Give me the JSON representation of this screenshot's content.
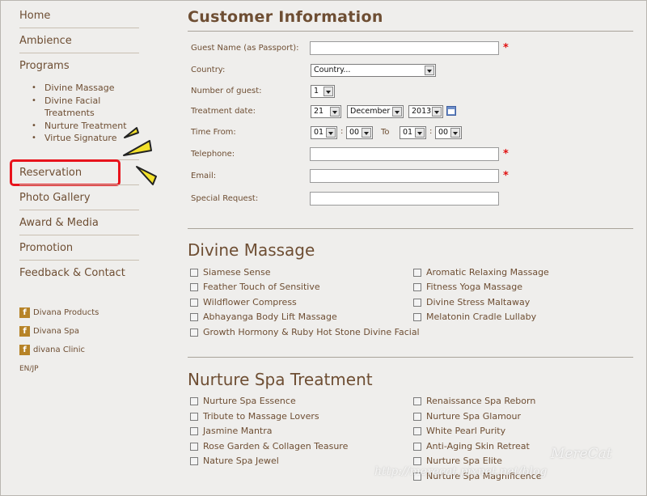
{
  "nav": {
    "home": "Home",
    "ambience": "Ambience",
    "programs": "Programs",
    "programs_sub": [
      "Divine Massage",
      "Divine Facial",
      "Treatments",
      "Nurture Treatment",
      "Virtue Signature"
    ],
    "reservation": "Reservation",
    "photo_gallery": "Photo Gallery",
    "award_media": "Award & Media",
    "promotion": "Promotion",
    "feedback": "Feedback & Contact"
  },
  "social": [
    {
      "icon": "facebook-icon",
      "label": "Divana Products"
    },
    {
      "icon": "facebook-icon",
      "label": "Divana Spa"
    },
    {
      "icon": "facebook-icon",
      "label": "divana Clinic"
    }
  ],
  "language": "EN/JP",
  "form": {
    "title": "Customer Information",
    "guest_name_label": "Guest Name (as Passport):",
    "country_label": "Country:",
    "country_value": "Country...",
    "guests_label": "Number of guest:",
    "guests_value": "1",
    "date_label": "Treatment date:",
    "day_value": "21",
    "month_value": "December",
    "year_value": "2013",
    "time_label": "Time From:",
    "hour_from": "01",
    "minute_from": "00",
    "time_to_label": "To",
    "hour_to": "01",
    "minute_to": "00",
    "telephone_label": "Telephone:",
    "email_label": "Email:",
    "special_label": "Special Request:",
    "required_mark": "*",
    "colon": ":"
  },
  "divine_massage": {
    "title": "Divine Massage",
    "left": [
      "Siamese Sense",
      "Feather Touch of Sensitive",
      "Wildflower Compress",
      "Abhayanga Body Lift Massage",
      "Growth Hormony & Ruby Hot Stone Divine Facial"
    ],
    "right": [
      "Aromatic Relaxing Massage",
      "Fitness Yoga Massage",
      "Divine Stress Maltaway",
      "Melatonin Cradle Lullaby"
    ]
  },
  "nurture": {
    "title": "Nurture Spa Treatment",
    "left": [
      "Nurture Spa Essence",
      "Tribute to Massage Lovers",
      "Jasmine Mantra",
      "Rose Garden & Collagen Teasure",
      "Nature Spa Jewel"
    ],
    "right": [
      "Renaissance Spa Reborn",
      "Nurture Spa Glamour",
      "White Pearl Purity",
      "Anti-Aging Skin Retreat",
      "Nurture Spa Elite",
      "Nurture Spa Magnificence"
    ]
  },
  "watermark": {
    "name": "MereCat",
    "url": "http://merecat.pixnet.net/blog"
  },
  "colors": {
    "brown_text": "#6e4e33",
    "highlight_red": "#e8131c",
    "required_red": "#e01010",
    "deco_yellow": "#f3e12a"
  }
}
